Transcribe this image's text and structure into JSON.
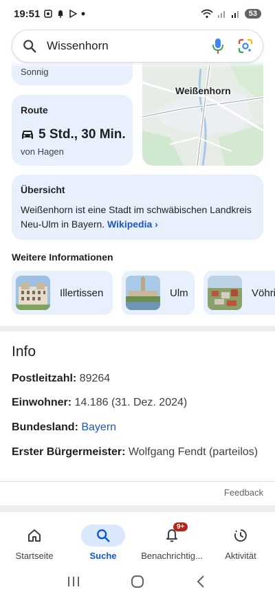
{
  "status_bar": {
    "time": "19:51",
    "battery": "53"
  },
  "search": {
    "query": "Wissenhorn"
  },
  "weather_card": {
    "condition": "Sonnig"
  },
  "route_card": {
    "title": "Route",
    "duration": "5 Std., 30 Min.",
    "from": "von Hagen"
  },
  "map": {
    "city_label": "Weißenhorn"
  },
  "overview": {
    "title": "Übersicht",
    "description": "Weißenhorn ist eine Stadt im schwäbischen Landkreis Neu-Ulm in Bayern.",
    "link": "Wikipedia ›"
  },
  "more_info": {
    "title": "Weitere Informationen",
    "items": [
      {
        "label": "Illertissen"
      },
      {
        "label": "Ulm"
      },
      {
        "label": "Vöhringen"
      }
    ]
  },
  "info": {
    "title": "Info",
    "postal_key": "Postleitzahl:",
    "postal_value": " 89264",
    "population_key": "Einwohner:",
    "population_value": " 14.186 (31. Dez. 2024)",
    "state_key": "Bundesland:",
    "state_value": "Bayern",
    "mayor_key": "Erster Bürgermeister:",
    "mayor_value": " Wolfgang Fendt (parteilos)",
    "feedback": "Feedback"
  },
  "bottom_nav": {
    "items": [
      {
        "label": "Startseite",
        "icon": "home-icon"
      },
      {
        "label": "Suche",
        "icon": "search-icon"
      },
      {
        "label": "Benachrichtig...",
        "icon": "bell-icon",
        "badge": "9+"
      },
      {
        "label": "Aktivität",
        "icon": "activity-icon"
      }
    ],
    "active": "Suche"
  },
  "colors": {
    "card_bg": "#e8f0fe",
    "accent": "#0b57d0",
    "link": "#1a57c2",
    "badge": "#b3261e"
  }
}
